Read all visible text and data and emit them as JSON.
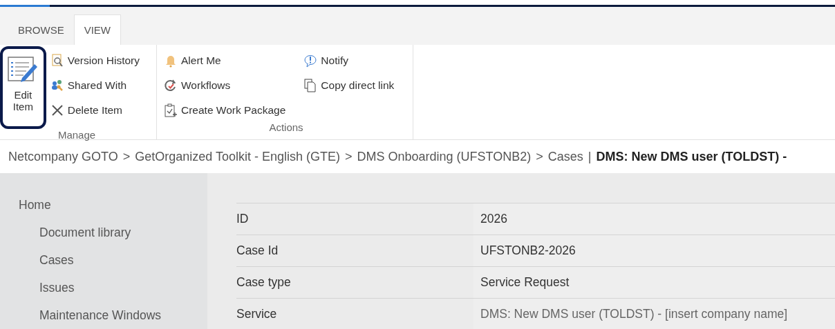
{
  "tabs": [
    {
      "label": "BROWSE",
      "selected": false
    },
    {
      "label": "VIEW",
      "selected": true
    }
  ],
  "ribbon": {
    "groups": [
      {
        "label": "Manage",
        "large": {
          "label": "Edit Item",
          "highlighted": true
        },
        "columns": [
          [
            {
              "label": "Version History"
            },
            {
              "label": "Shared With"
            },
            {
              "label": "Delete Item"
            }
          ]
        ]
      },
      {
        "label": "Actions",
        "columns": [
          [
            {
              "label": "Alert Me"
            },
            {
              "label": "Workflows"
            },
            {
              "label": "Create Work Package"
            }
          ],
          [
            {
              "label": "Notify"
            },
            {
              "label": "Copy direct link"
            }
          ]
        ]
      }
    ]
  },
  "breadcrumb": {
    "items": [
      {
        "label": "Netcompany GOTO",
        "separator": ">"
      },
      {
        "label": "GetOrganized Toolkit - English (GTE)",
        "separator": ">"
      },
      {
        "label": "DMS Onboarding (UFSTONB2)",
        "separator": ">"
      },
      {
        "label": "Cases",
        "separator": "|"
      }
    ],
    "current": "DMS: New DMS user (TOLDST) -"
  },
  "sidebar": {
    "items": [
      {
        "label": "Home",
        "children": [
          {
            "label": "Document library"
          },
          {
            "label": "Cases"
          },
          {
            "label": "Issues"
          },
          {
            "label": "Maintenance Windows"
          }
        ]
      }
    ]
  },
  "table": {
    "rows": [
      {
        "label": "ID",
        "value": "2026",
        "kind": "text"
      },
      {
        "label": "Case Id",
        "value": "UFSTONB2-2026",
        "kind": "text"
      },
      {
        "label": "Case type",
        "value": "Service Request",
        "kind": "text"
      },
      {
        "label": "Service",
        "value": "DMS: New DMS user (TOLDST) - [insert company name]",
        "kind": "link"
      }
    ]
  }
}
